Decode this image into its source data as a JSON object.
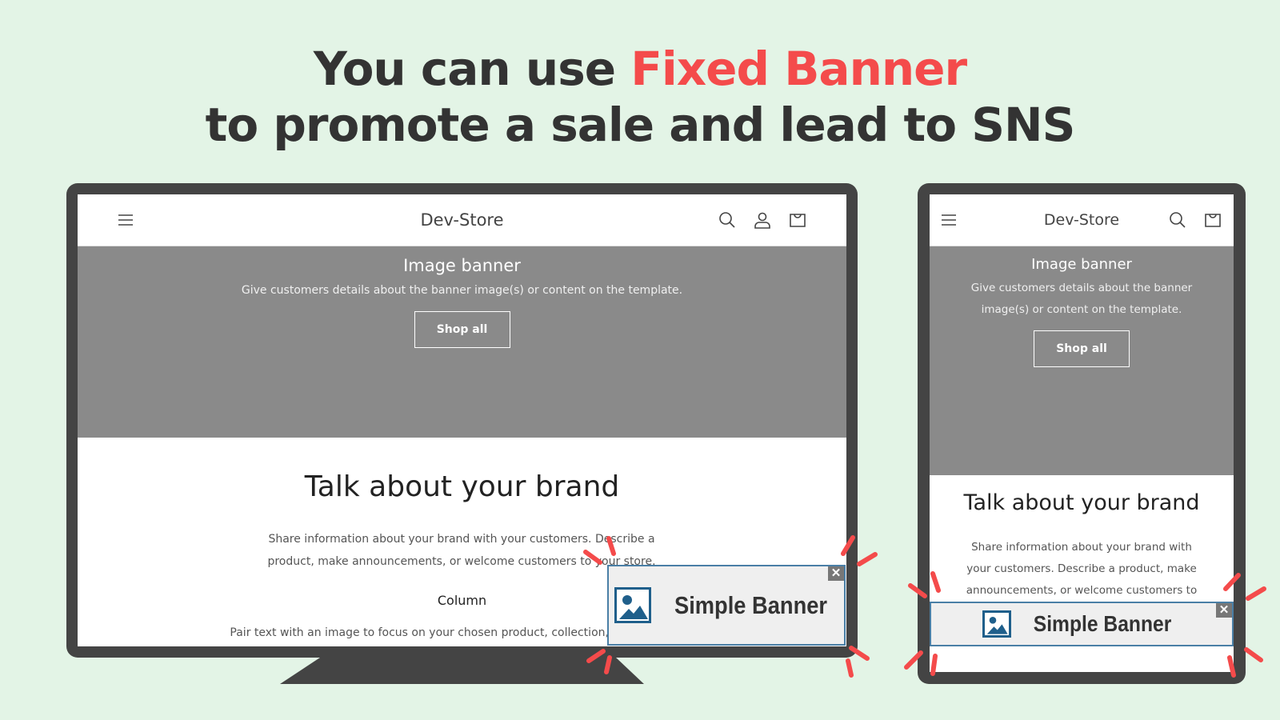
{
  "headline": {
    "line1_pre": "You can use ",
    "line1_accent": "Fixed Banner",
    "line2": "to promote a sale and lead to SNS"
  },
  "colors": {
    "accent": "#f44b4b",
    "background": "#e3f4e6",
    "device": "#444444",
    "hero": "#8a8a8a",
    "banner_border": "#4a7fa6",
    "banner_icon": "#1f5f8b"
  },
  "desktop": {
    "store_name": "Dev-Store",
    "icons": [
      "menu-icon",
      "search-icon",
      "account-icon",
      "cart-icon"
    ],
    "hero": {
      "title": "Image banner",
      "subtitle": "Give customers details about the banner image(s) or content on the template.",
      "button": "Shop all"
    },
    "brand": {
      "title": "Talk about your brand",
      "text": "Share information about your brand with your customers. Describe a product, make announcements, or welcome customers to your store."
    },
    "column": {
      "title": "Column",
      "text": "Pair text with an image to focus on your chosen product, collection, or blog post. A"
    },
    "banner": {
      "label": "Simple Banner",
      "close": "✕"
    }
  },
  "mobile": {
    "store_name": "Dev-Store",
    "icons": [
      "menu-icon",
      "search-icon",
      "cart-icon"
    ],
    "hero": {
      "title": "Image banner",
      "subtitle": "Give customers details about the banner image(s) or content on the template.",
      "button": "Shop all"
    },
    "brand": {
      "title": "Talk about your brand",
      "text": "Share information about your brand with your customers. Describe a product, make announcements, or welcome customers to"
    },
    "banner": {
      "label": "Simple Banner",
      "close": "✕"
    }
  }
}
